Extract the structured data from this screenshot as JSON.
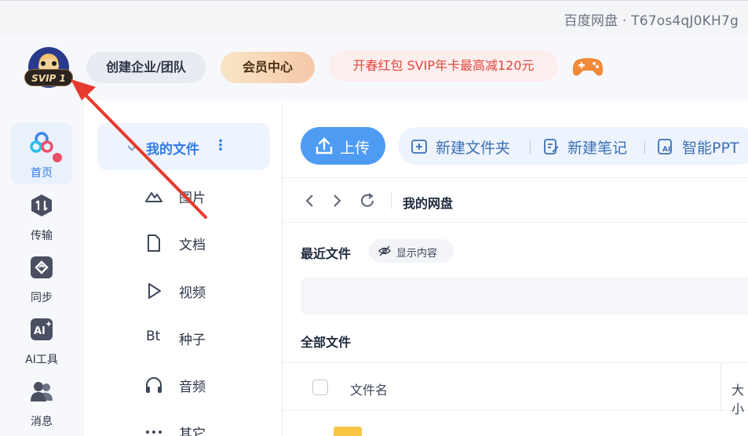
{
  "window": {
    "title": "百度网盘 · T67os4qJ0KH7g"
  },
  "header": {
    "svip_badge": "SVIP 1",
    "create_team": "创建企业/团队",
    "member_center": "会员中心",
    "promo": "开春红包 SVIP年卡最高减120元",
    "game_icon": "gamepad-icon"
  },
  "rail": {
    "items": [
      {
        "label": "首页",
        "icon": "home-cloud-icon",
        "active": true
      },
      {
        "label": "传输",
        "icon": "transfer-icon"
      },
      {
        "label": "同步",
        "icon": "sync-icon"
      },
      {
        "label": "AI工具",
        "icon": "ai-tools-icon"
      },
      {
        "label": "消息",
        "icon": "message-icon"
      }
    ]
  },
  "categories": {
    "active": "我的文件",
    "more": "⋮",
    "items": [
      {
        "label": "图片",
        "icon": "image-icon"
      },
      {
        "label": "文档",
        "icon": "document-icon"
      },
      {
        "label": "视频",
        "icon": "video-icon"
      },
      {
        "label": "种子",
        "icon": "torrent-icon",
        "prefix": "Bt"
      },
      {
        "label": "音频",
        "icon": "audio-icon"
      },
      {
        "label": "其它",
        "icon": "more-icon"
      }
    ]
  },
  "toolbar": {
    "upload": "上传",
    "new_folder": "新建文件夹",
    "new_note": "新建笔记",
    "smart_ppt": "智能PPT"
  },
  "nav": {
    "breadcrumb": "我的网盘"
  },
  "recent": {
    "title": "最近文件",
    "toggle": "显示内容"
  },
  "all_files": {
    "title": "全部文件",
    "columns": {
      "name": "文件名",
      "size": "大小"
    }
  },
  "colors": {
    "accent": "#2f7be8",
    "upload": "#4e9bf3",
    "promo": "#e0473d",
    "notify_dot": "#ee4e63",
    "annotation_arrow": "#e63a2e"
  }
}
